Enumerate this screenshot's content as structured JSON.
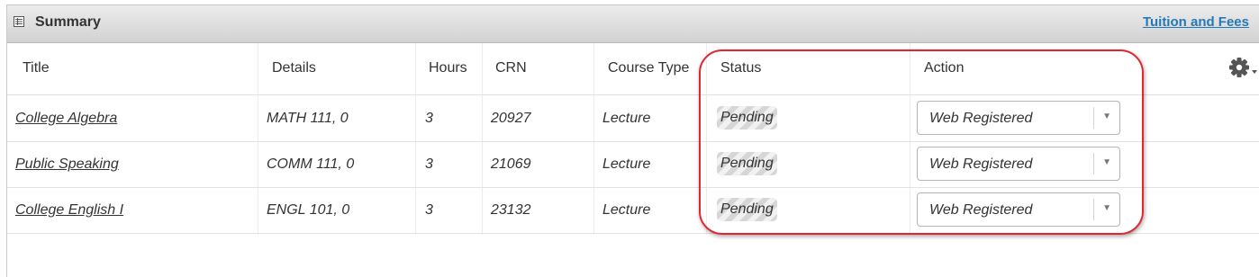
{
  "panel": {
    "title": "Summary",
    "icon": "table-list-icon",
    "tuition_link": "Tuition and Fees"
  },
  "table": {
    "columns": [
      "Title",
      "Details",
      "Hours",
      "CRN",
      "Course Type",
      "Status",
      "Action"
    ],
    "rows": [
      {
        "title": "College Algebra",
        "details": "MATH 111, 0",
        "hours": "3",
        "crn": "20927",
        "course_type": "Lecture",
        "status": "Pending",
        "action": "Web Registered"
      },
      {
        "title": "Public Speaking",
        "details": "COMM 111, 0",
        "hours": "3",
        "crn": "21069",
        "course_type": "Lecture",
        "status": "Pending",
        "action": "Web Registered"
      },
      {
        "title": "College English I",
        "details": "ENGL 101, 0",
        "hours": "3",
        "crn": "23132",
        "course_type": "Lecture",
        "status": "Pending",
        "action": "Web Registered"
      }
    ],
    "settings_icon": "gear-icon"
  },
  "colors": {
    "link": "#2479b9",
    "highlight": "#e0262e",
    "header_gradient_top": "#ececec",
    "header_gradient_bottom": "#d2d2d2"
  }
}
